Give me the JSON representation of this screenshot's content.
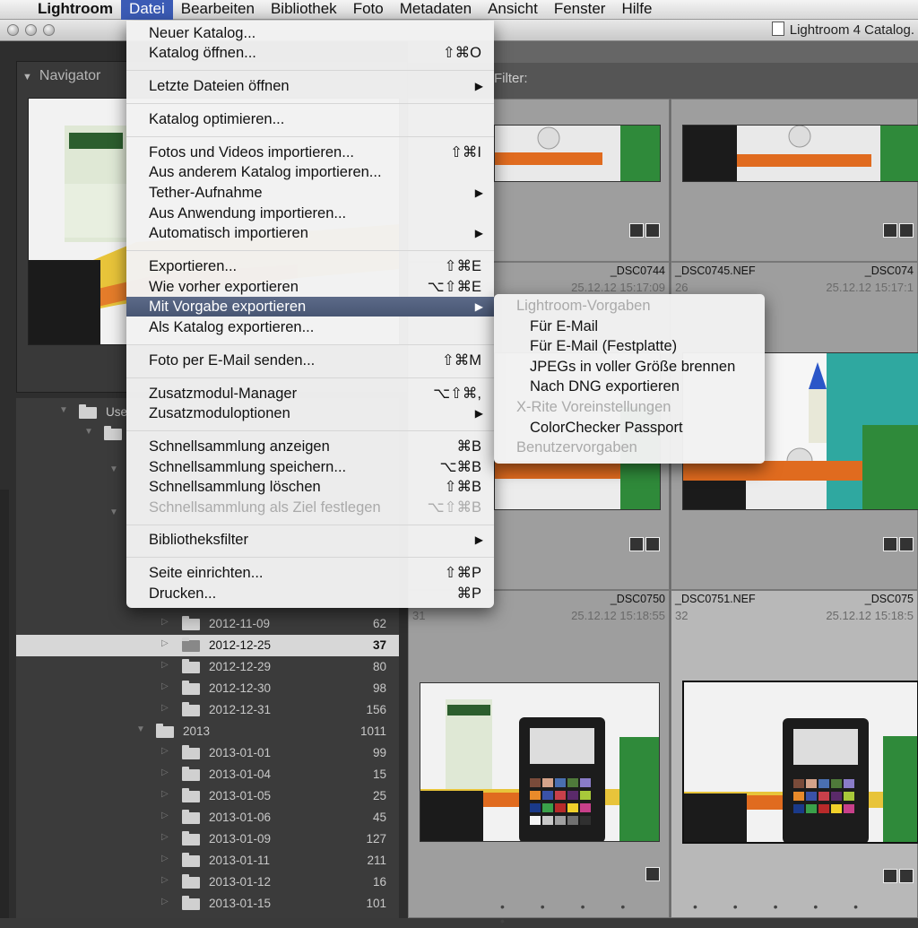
{
  "menubar": {
    "app": "Lightroom",
    "items": [
      "Datei",
      "Bearbeiten",
      "Bibliothek",
      "Foto",
      "Metadaten",
      "Ansicht",
      "Fenster",
      "Hilfe"
    ]
  },
  "window": {
    "title": "Lightroom 4 Catalog."
  },
  "navigator": {
    "label": "Navigator"
  },
  "grid": {
    "filter_label": "Filter:"
  },
  "folders": {
    "partial_root": "Use",
    "rows": [
      {
        "name": "2012-11-09",
        "count": "62"
      },
      {
        "name": "2012-12-25",
        "count": "37"
      },
      {
        "name": "2012-12-29",
        "count": "80"
      },
      {
        "name": "2012-12-30",
        "count": "98"
      },
      {
        "name": "2012-12-31",
        "count": "156"
      },
      {
        "name": "2013",
        "count": "1011"
      },
      {
        "name": "2013-01-01",
        "count": "99"
      },
      {
        "name": "2013-01-04",
        "count": "15"
      },
      {
        "name": "2013-01-05",
        "count": "25"
      },
      {
        "name": "2013-01-06",
        "count": "45"
      },
      {
        "name": "2013-01-09",
        "count": "127"
      },
      {
        "name": "2013-01-11",
        "count": "211"
      },
      {
        "name": "2013-01-12",
        "count": "16"
      },
      {
        "name": "2013-01-15",
        "count": "101"
      }
    ]
  },
  "cells": {
    "r2c1": {
      "file": "_DSC0744",
      "date": "25.12.12 15:17:09"
    },
    "r2c2": {
      "file": "_DSC0745.NEF",
      "file2": "_DSC074",
      "index": "26",
      "date": "25.12.12 15:17:1"
    },
    "r3c1": {
      "file": "_DSC0750",
      "index": "31",
      "date": "25.12.12 15:18:55"
    },
    "r3c2": {
      "file": "_DSC0751.NEF",
      "file2": "_DSC075",
      "index": "32",
      "date": "25.12.12 15:18:5"
    }
  },
  "menu": {
    "items": [
      {
        "label": "Neuer Katalog...",
        "shortcut": ""
      },
      {
        "label": "Katalog öffnen...",
        "shortcut": "⇧⌘O"
      },
      {
        "label": "Letzte Dateien öffnen",
        "arrow": "▶"
      },
      {
        "label": "Katalog optimieren..."
      },
      {
        "label": "Fotos und Videos importieren...",
        "shortcut": "⇧⌘I"
      },
      {
        "label": "Aus anderem Katalog importieren..."
      },
      {
        "label": "Tether-Aufnahme",
        "arrow": "▶"
      },
      {
        "label": "Aus Anwendung importieren..."
      },
      {
        "label": "Automatisch importieren",
        "arrow": "▶"
      },
      {
        "label": "Exportieren...",
        "shortcut": "⇧⌘E"
      },
      {
        "label": "Wie vorher exportieren",
        "shortcut": "⌥⇧⌘E"
      },
      {
        "label": "Mit Vorgabe exportieren",
        "arrow": "▶"
      },
      {
        "label": "Als Katalog exportieren..."
      },
      {
        "label": "Foto per E-Mail senden...",
        "shortcut": "⇧⌘M"
      },
      {
        "label": "Zusatzmodul-Manager",
        "shortcut": "⌥⇧⌘,"
      },
      {
        "label": "Zusatzmoduloptionen",
        "arrow": "▶"
      },
      {
        "label": "Schnellsammlung anzeigen",
        "shortcut": "⌘B"
      },
      {
        "label": "Schnellsammlung speichern...",
        "shortcut": "⌥⌘B"
      },
      {
        "label": "Schnellsammlung löschen",
        "shortcut": "⇧⌘B"
      },
      {
        "label": "Schnellsammlung als Ziel festlegen",
        "shortcut": "⌥⇧⌘B"
      },
      {
        "label": "Bibliotheksfilter",
        "arrow": "▶"
      },
      {
        "label": "Seite einrichten...",
        "shortcut": "⇧⌘P"
      },
      {
        "label": "Drucken...",
        "shortcut": "⌘P"
      }
    ]
  },
  "submenu": {
    "group1": "Lightroom-Vorgaben",
    "items1": [
      "Für E-Mail",
      "Für E-Mail (Festplatte)",
      "JPEGs in voller Größe brennen",
      "Nach DNG exportieren"
    ],
    "group2": "X-Rite Voreinstellungen",
    "items2": [
      "ColorChecker Passport"
    ],
    "group3": "Benutzervorgaben"
  },
  "colors": {
    "menu_highlight": "#55627f",
    "menubar_active": "#3b5bb5"
  }
}
